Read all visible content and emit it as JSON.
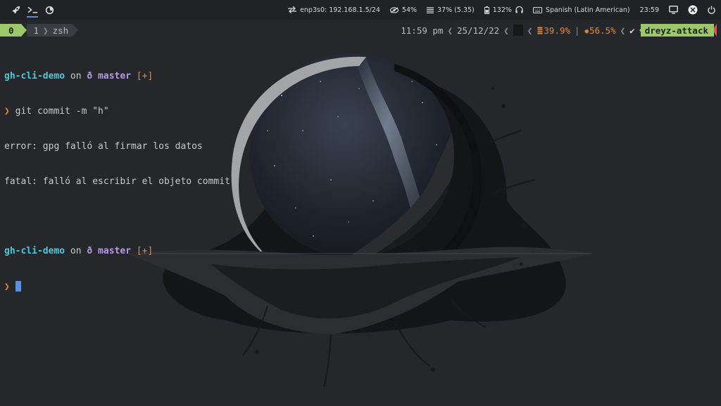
{
  "topbar": {
    "left_icons": [
      "rocket-icon",
      "terminal-icon",
      "firefox-icon"
    ],
    "network": "enp3s0: 192.168.1.5/24",
    "volume": "54%",
    "memory": "37% (5.35)",
    "brightness_audio": "132%",
    "keyboard": "Spanish (Latin American)",
    "clock": "23:59"
  },
  "tmux": {
    "session": "0",
    "window_index": "1",
    "window_name": "zsh",
    "time": "11:59 pm",
    "date": "25/12/22",
    "cpu": "39.9%",
    "mem": "56.5%",
    "check": "✔",
    "host": "dreyz-attack"
  },
  "terminal": {
    "prompt1": {
      "dir": "gh-cli-demo",
      "on": " on ",
      "branch_symbol": "ð",
      "branch": " master",
      "status": " [+]"
    },
    "command": "git commit -m \"h\"",
    "caret": "❯",
    "error1": "error: gpg falló al firmar los datos",
    "error2": "fatal: falló al escribir el objeto commit",
    "prompt2": {
      "dir": "gh-cli-demo",
      "on": " on ",
      "branch_symbol": "ð",
      "branch": " master",
      "status": " [+]"
    }
  },
  "colors": {
    "accent_green": "#9cc86a",
    "prompt_cyan": "#4fc7d9",
    "branch_purple": "#b79be8",
    "orange": "#e08b3b",
    "cursor_blue": "#5a8fe6"
  }
}
